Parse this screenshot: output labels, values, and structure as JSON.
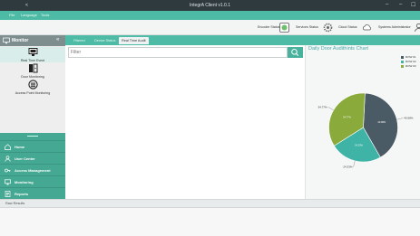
{
  "window": {
    "title": "IntegrA Client v1.0.1",
    "left_marker": "<",
    "controls": [
      "–",
      "–",
      "☐"
    ]
  },
  "menu": {
    "items": [
      "File",
      "Language",
      "Tools"
    ]
  },
  "status": {
    "items": [
      {
        "label": "Encoder Status"
      },
      {
        "label": "Services Status"
      },
      {
        "label": "Cloud Status"
      },
      {
        "label": "Systems Administrator"
      }
    ]
  },
  "sidebar": {
    "header": {
      "label": "Monitor",
      "chevron": "«"
    },
    "tools": [
      {
        "label": "Real Time Event",
        "icon": "monitor-icon"
      },
      {
        "label": "Door Monitoring",
        "icon": "door-icon"
      },
      {
        "label": "Access Point Monitoring",
        "icon": "access-point-icon"
      }
    ]
  },
  "nav": {
    "items": [
      {
        "label": "Home",
        "icon": "home-icon"
      },
      {
        "label": "User Center",
        "icon": "user-icon"
      },
      {
        "label": "Access Management",
        "icon": "key-icon"
      },
      {
        "label": "Monitoring",
        "icon": "monitor-icon"
      },
      {
        "label": "Reports",
        "icon": "report-icon"
      }
    ]
  },
  "tabs": [
    {
      "label": "Filtered"
    },
    {
      "label": "Device Status"
    },
    {
      "label": "Real Time Audit"
    }
  ],
  "filter": {
    "placeholder": "Filter",
    "value": ""
  },
  "bottom": {
    "title": "Raw Results"
  },
  "colors": {
    "accent": "#4dbba5",
    "accent_dark": "#44a892",
    "slice_1": "#4a5b66",
    "slice_2": "#3fb3a6",
    "slice_3": "#8aaa3c"
  },
  "chart_data": {
    "type": "pie",
    "title": "Daily Door Audithints Chart",
    "legend": [
      "ROW 01",
      "ROW 02",
      "ROW 03"
    ],
    "legend_position": "top-right",
    "slices": [
      {
        "name": "ROW 01",
        "value": 40.98,
        "label": "40.98%",
        "color": "#4a5b66"
      },
      {
        "name": "ROW 02",
        "value": 24.33,
        "label": "24.33%",
        "color": "#3fb3a6"
      },
      {
        "name": "ROW 03",
        "value": 34.77,
        "label": "34.77%",
        "color": "#8aaa3c"
      }
    ]
  }
}
